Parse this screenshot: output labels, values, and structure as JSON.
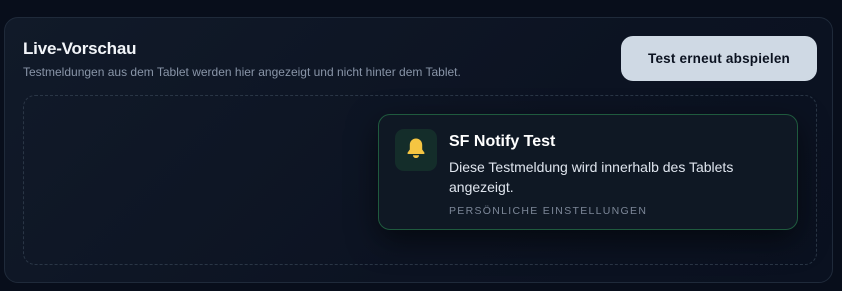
{
  "panel": {
    "title": "Live-Vorschau",
    "subtitle": "Testmeldungen aus dem Tablet werden hier angezeigt und nicht hinter dem Tablet."
  },
  "replay_button": {
    "label": "Test erneut abspielen"
  },
  "notification": {
    "icon": "bell-icon",
    "title": "SF Notify Test",
    "message": "Diese Testmeldung wird innerhalb des Tablets angezeigt.",
    "category": "PERSÖNLICHE EINSTELLUNGEN",
    "accent_color": "#1f5a3e",
    "icon_color": "#f5c542"
  },
  "colors": {
    "background": "#080e1b",
    "button_background": "#cfd9e4"
  }
}
